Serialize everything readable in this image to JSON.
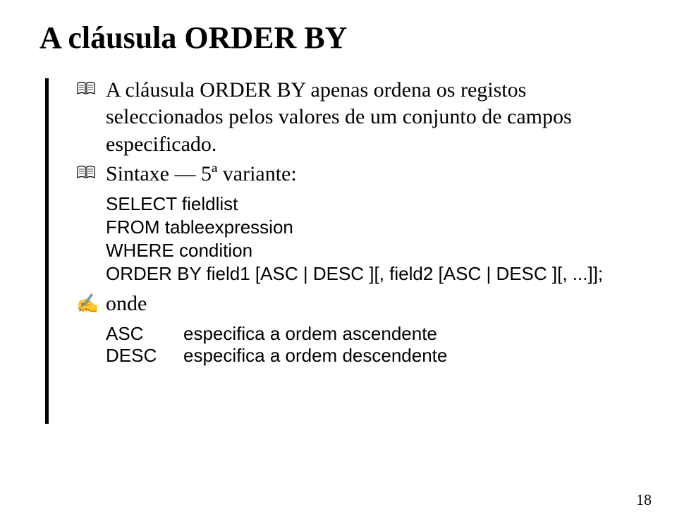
{
  "title": "A cláusula ORDER BY",
  "bullets": [
    {
      "type": "book",
      "text": "A cláusula ORDER BY apenas ordena os registos seleccionados pelos valores de um conjunto de campos especificado."
    },
    {
      "type": "book",
      "text": "Sintaxe — 5ª variante:"
    }
  ],
  "code": [
    "SELECT fieldlist",
    "FROM tableexpression",
    "WHERE condition",
    "ORDER BY field1 [ASC | DESC ][, field2 [ASC | DESC ][, ...]];"
  ],
  "onde_label": "onde",
  "definitions": [
    {
      "key": "ASC",
      "value": "especifica a ordem ascendente"
    },
    {
      "key": "DESC",
      "value": "especifica a ordem descendente"
    }
  ],
  "page_number": "18"
}
